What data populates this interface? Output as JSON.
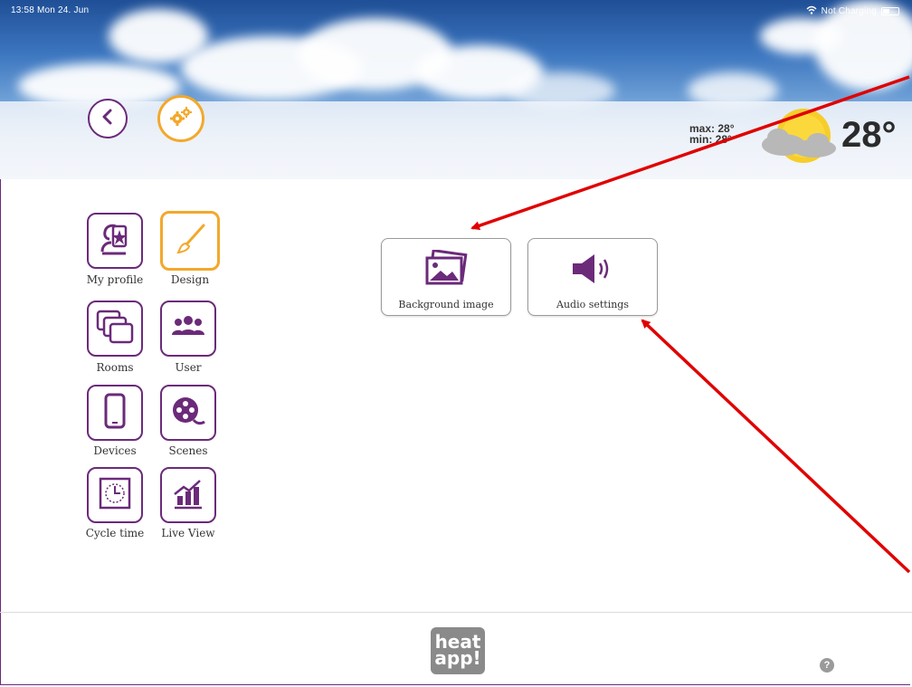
{
  "status_bar": {
    "time_date": "13:58  Mon 24. Jun",
    "charging": "Not Charging"
  },
  "header": {
    "weather": {
      "max": "max: 28°",
      "min": "min: 28°",
      "temperature": "28°",
      "icon": "partly-cloudy-icon"
    },
    "back_icon": "chevron-left-icon",
    "settings_icon": "gears-icon"
  },
  "menu": {
    "items": [
      {
        "label": "My profile",
        "icon": "profile-star-icon",
        "active": false
      },
      {
        "label": "Design",
        "icon": "paintbrush-icon",
        "active": true
      },
      {
        "label": "Rooms",
        "icon": "rooms-icon",
        "active": false
      },
      {
        "label": "User",
        "icon": "users-icon",
        "active": false
      },
      {
        "label": "Devices",
        "icon": "phone-icon",
        "active": false
      },
      {
        "label": "Scenes",
        "icon": "film-reel-icon",
        "active": false
      },
      {
        "label": "Cycle time",
        "icon": "clock-icon",
        "active": false
      },
      {
        "label": "Live View",
        "icon": "chart-icon",
        "active": false
      }
    ]
  },
  "options": [
    {
      "label": "Background image",
      "icon": "image-gallery-icon"
    },
    {
      "label": "Audio settings",
      "icon": "speaker-icon"
    }
  ],
  "footer": {
    "logo_text": "heat app!",
    "help": "?"
  },
  "colors": {
    "brand_purple": "#6b2a7a",
    "accent_orange": "#f3a82b",
    "annotation_red": "#e00000"
  }
}
